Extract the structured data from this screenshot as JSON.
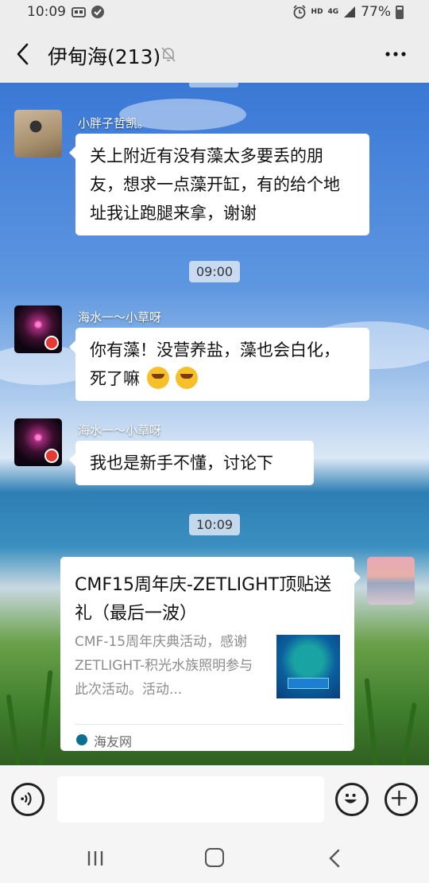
{
  "status_bar": {
    "time": "10:09",
    "battery": "77%",
    "network_hd": "HD",
    "network_4g": "4G"
  },
  "header": {
    "title": "伊甸海(213)"
  },
  "messages": [
    {
      "sender": "小胖子哲凯。",
      "text": "关上附近有没有藻太多要丢的朋友，想求一点藻开缸，有的给个地址我让跑腿来拿，谢谢"
    },
    {
      "time": "09:00"
    },
    {
      "sender": "海水一～小草呀",
      "text": "你有藻！没营养盐，藻也会白化，死了嘛"
    },
    {
      "sender": "海水一～小草呀",
      "text": "我也是新手不懂，讨论下"
    },
    {
      "time": "10:09"
    },
    {
      "card": {
        "title": "CMF15周年庆-ZETLIGHT顶贴送礼（最后一波）",
        "description": "CMF-15周年庆典活动，感谢ZETLIGHT-积光水族照明参与此次活动。活动...",
        "source": "海友网"
      }
    }
  ],
  "colors": {
    "accent_badge": "#e53935",
    "bubble": "#ffffff",
    "bar_bg": "#ededed"
  }
}
